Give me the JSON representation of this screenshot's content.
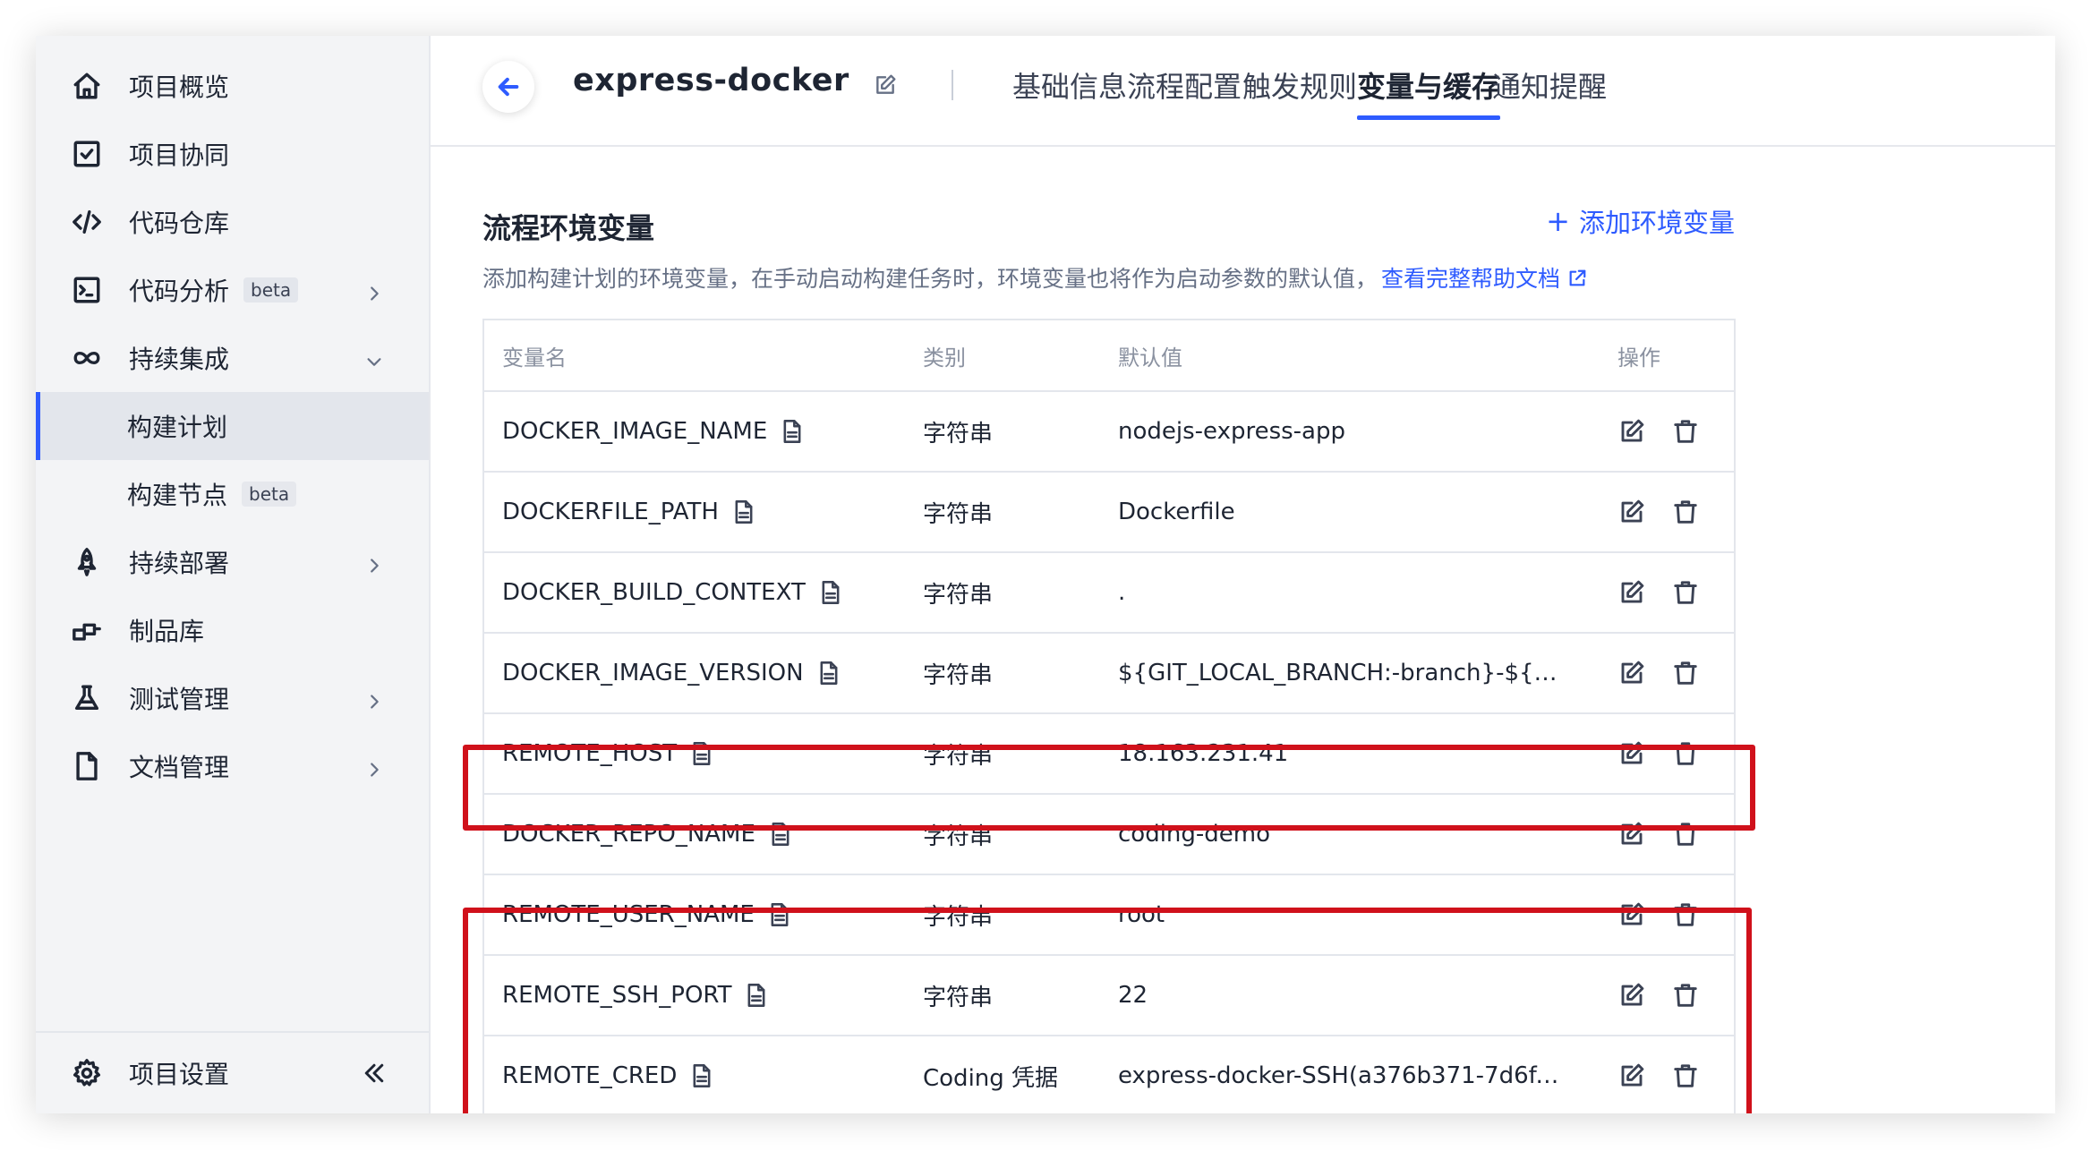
{
  "sidebar": {
    "items": [
      {
        "label": "项目概览",
        "icon": "home-icon"
      },
      {
        "label": "项目协同",
        "icon": "checkbox-icon"
      },
      {
        "label": "代码仓库",
        "icon": "code-icon"
      },
      {
        "label": "代码分析",
        "icon": "terminal-icon",
        "badge": "beta",
        "arrow": "chevron-right-icon"
      },
      {
        "label": "持续集成",
        "icon": "infinity-icon",
        "arrow": "chevron-down-icon"
      },
      {
        "label": "构建计划",
        "active": true
      },
      {
        "label": "构建节点",
        "badge": "beta"
      },
      {
        "label": "持续部署",
        "icon": "rocket-icon",
        "arrow": "chevron-right-icon"
      },
      {
        "label": "制品库",
        "icon": "artifact-icon"
      },
      {
        "label": "测试管理",
        "icon": "flask-icon",
        "arrow": "chevron-right-icon"
      },
      {
        "label": "文档管理",
        "icon": "document-icon",
        "arrow": "chevron-right-icon"
      }
    ],
    "footer": {
      "label": "项目设置",
      "icon": "gear-icon",
      "collapse_icon": "double-chevron-left-icon"
    }
  },
  "header": {
    "project_title": "express-docker",
    "tabs": [
      "基础信息",
      "流程配置",
      "触发规则",
      "变量与缓存",
      "通知提醒"
    ],
    "active_tab": "变量与缓存"
  },
  "section": {
    "title": "流程环境变量",
    "add_button": "添加环境变量",
    "add_symbol": "+",
    "description": "添加构建计划的环境变量，在手动启动构建任务时，环境变量也将作为启动参数的默认值，",
    "help_link": "查看完整帮助文档"
  },
  "table": {
    "headers": {
      "name": "变量名",
      "type": "类别",
      "default": "默认值",
      "ops": "操作"
    },
    "rows": [
      {
        "name": "DOCKER_IMAGE_NAME",
        "type": "字符串",
        "value": "nodejs-express-app"
      },
      {
        "name": "DOCKERFILE_PATH",
        "type": "字符串",
        "value": "Dockerfile"
      },
      {
        "name": "DOCKER_BUILD_CONTEXT",
        "type": "字符串",
        "value": "."
      },
      {
        "name": "DOCKER_IMAGE_VERSION",
        "type": "字符串",
        "value": "${GIT_LOCAL_BRANCH:-branch}-${GI..."
      },
      {
        "name": "REMOTE_HOST",
        "type": "字符串",
        "value": "18.163.231.41"
      },
      {
        "name": "DOCKER_REPO_NAME",
        "type": "字符串",
        "value": "coding-demo"
      },
      {
        "name": "REMOTE_USER_NAME",
        "type": "字符串",
        "value": "root"
      },
      {
        "name": "REMOTE_SSH_PORT",
        "type": "字符串",
        "value": "22"
      },
      {
        "name": "REMOTE_CRED",
        "type": "Coding 凭据",
        "value": "express-docker-SSH(a376b371-7d6f-..."
      }
    ]
  },
  "colors": {
    "accent": "#2e5bff",
    "highlight": "#d0111b"
  }
}
